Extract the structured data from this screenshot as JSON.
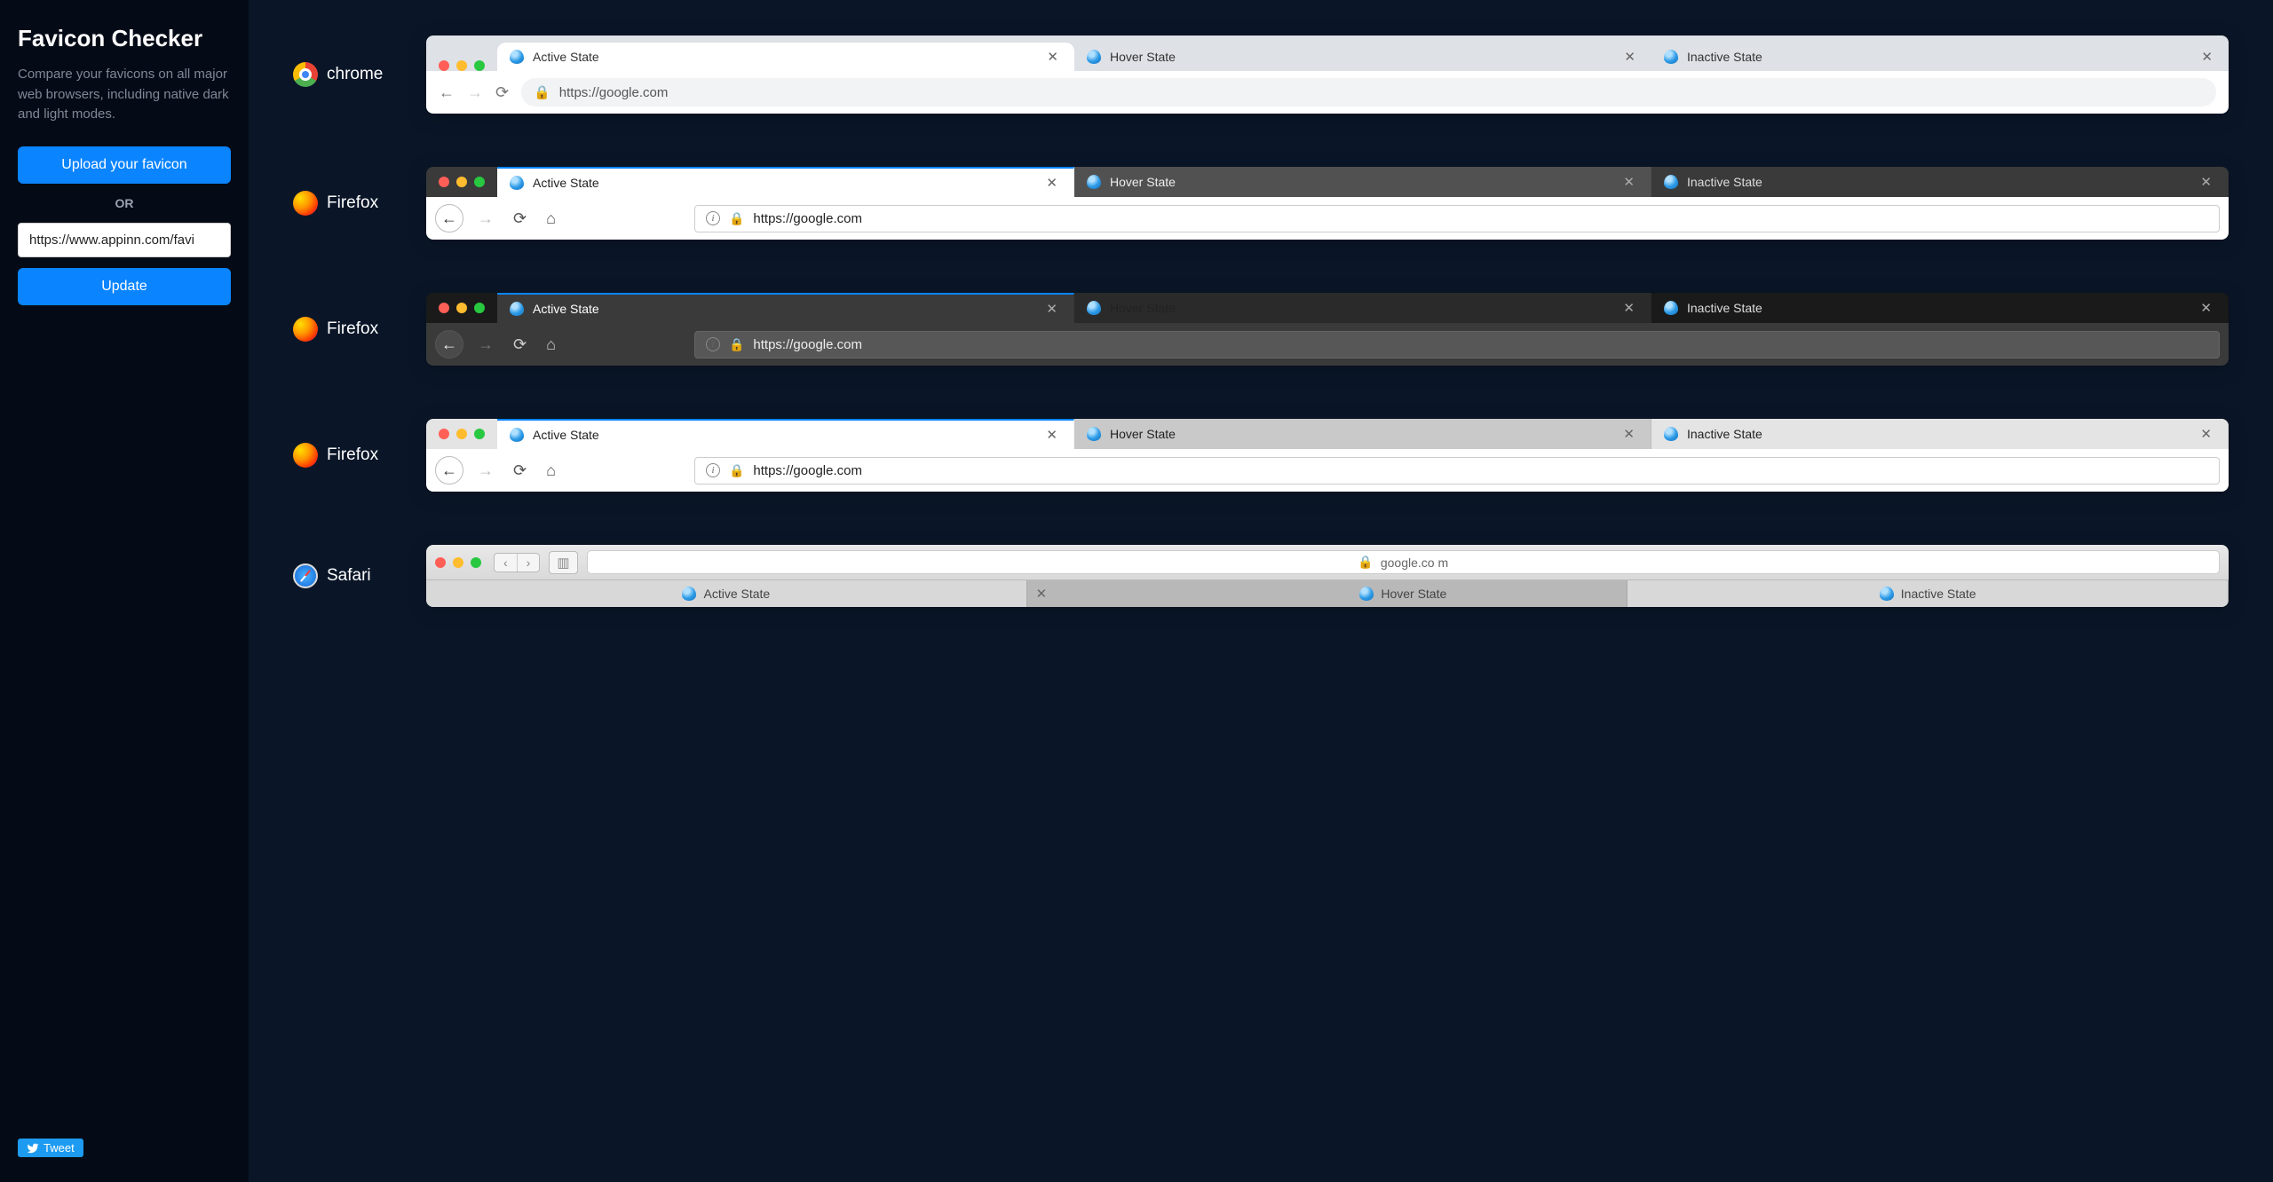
{
  "sidebar": {
    "title": "Favicon Checker",
    "subtitle": "Compare your favicons on all major web browsers, including native dark and light modes.",
    "upload_label": "Upload your favicon",
    "or_label": "OR",
    "url_value": "https://www.appinn.com/favi",
    "update_label": "Update",
    "tweet_label": "Tweet"
  },
  "tab_states": {
    "active": "Active State",
    "hover": "Hover State",
    "inactive": "Inactive State"
  },
  "address_url": "https://google.com",
  "safari_url": "google.co m",
  "browsers": {
    "chrome": "chrome",
    "firefox": "Firefox",
    "safari": "Safari"
  }
}
